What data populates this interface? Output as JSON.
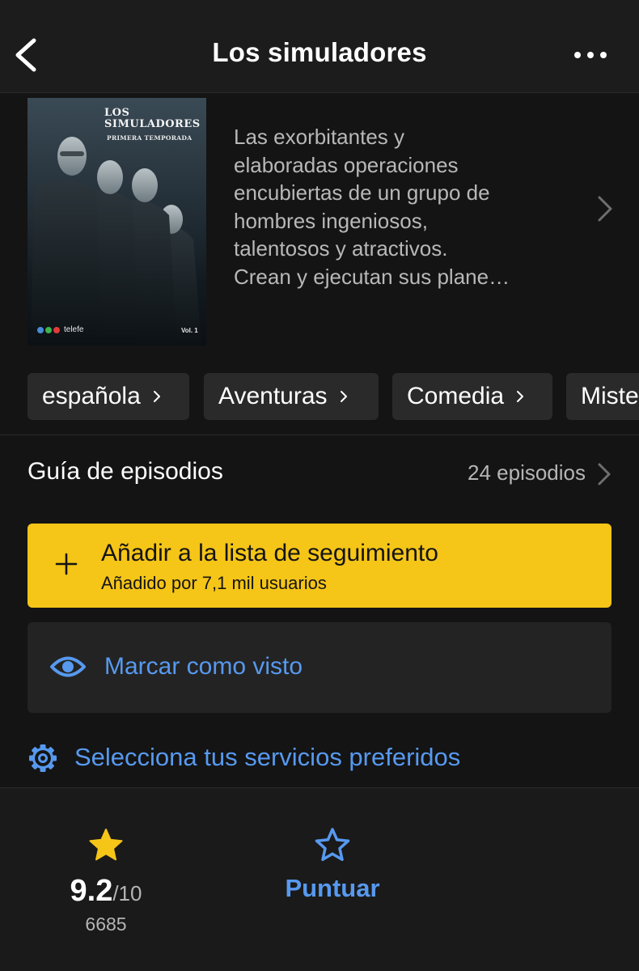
{
  "header": {
    "title": "Los simuladores"
  },
  "poster": {
    "title_line1": "LOS",
    "title_line2": "SIMULADORES",
    "subtitle": "PRIMERA TEMPORADA",
    "brand": "telefe",
    "volume": "Vol. 1"
  },
  "synopsis": {
    "lines": [
      "Las exorbitantes y",
      "elaboradas operaciones",
      "encubiertas de un grupo de",
      "hombres ingeniosos,",
      "talentosos y atractivos.",
      "Crean y ejecutan sus plane…"
    ]
  },
  "genres": [
    {
      "label": "española"
    },
    {
      "label": "Aventuras"
    },
    {
      "label": "Comedia"
    },
    {
      "label": "Miste"
    }
  ],
  "episodes": {
    "title": "Guía de episodios",
    "count": "24 episodios"
  },
  "watchlist": {
    "title": "Añadir a la lista de seguimiento",
    "subtitle": "Añadido por 7,1 mil usuarios"
  },
  "seen": {
    "label": "Marcar como visto"
  },
  "services": {
    "label": "Selecciona tus servicios preferidos"
  },
  "rating": {
    "value": "9.2",
    "out_of": "/10",
    "count": "6685",
    "rate_label": "Puntuar"
  },
  "colors": {
    "background": "#141414",
    "accent_yellow": "#f5c518",
    "link_blue": "#5799ef",
    "chip_bg": "#2a2a2a"
  },
  "icons": {
    "back": "chevron-left-icon",
    "more": "more-horizontal-icon",
    "add": "plus-icon",
    "seen": "eye-icon",
    "services": "gear-icon",
    "rating": "star-filled-icon",
    "rate": "star-outline-icon"
  }
}
